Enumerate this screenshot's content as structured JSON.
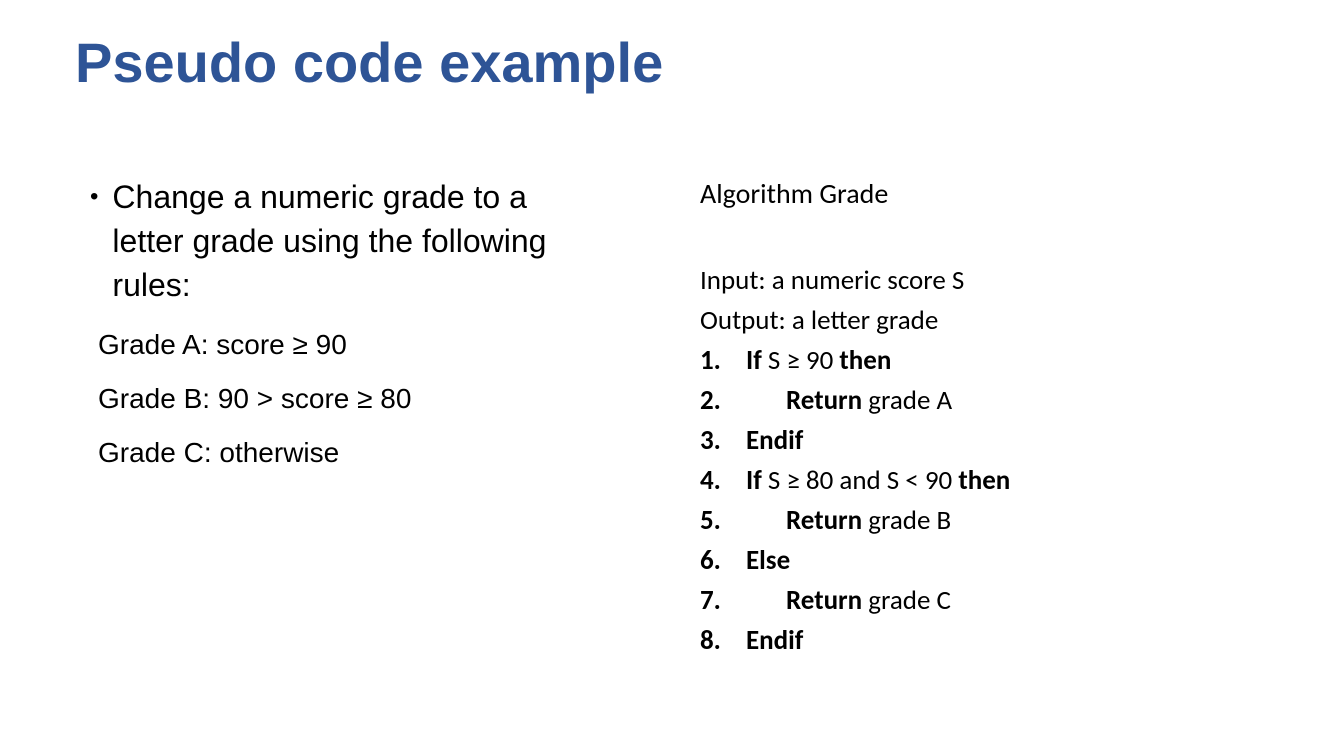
{
  "title": "Pseudo code example",
  "left": {
    "bullet": "Change a numeric grade to a letter grade using the following rules:",
    "rules": [
      "Grade A: score ≥ 90",
      "Grade B:  90 > score ≥ 80",
      "Grade C: otherwise"
    ]
  },
  "right": {
    "algoTitle": "Algorithm Grade",
    "input": "Input: a numeric score S",
    "output": "Output: a letter grade",
    "steps": [
      {
        "n": "1.",
        "bold1": "If",
        "mid": " S ≥ 90 ",
        "bold2": "then",
        "indent": false
      },
      {
        "n": "2.",
        "bold1": "Return",
        "mid": " grade A",
        "bold2": "",
        "indent": true
      },
      {
        "n": "3.",
        "bold1": "Endif",
        "mid": "",
        "bold2": "",
        "indent": false
      },
      {
        "n": "4.",
        "bold1": "If",
        "mid": " S ≥ 80 and S < 90 ",
        "bold2": "then",
        "indent": false
      },
      {
        "n": "5.",
        "bold1": "Return",
        "mid": " grade B",
        "bold2": "",
        "indent": true
      },
      {
        "n": "6.",
        "bold1": "Else",
        "mid": "",
        "bold2": "",
        "indent": false
      },
      {
        "n": "7.",
        "bold1": "Return",
        "mid": " grade C",
        "bold2": "",
        "indent": true
      },
      {
        "n": "8.",
        "bold1": "Endif",
        "mid": "",
        "bold2": "",
        "indent": false
      }
    ]
  }
}
